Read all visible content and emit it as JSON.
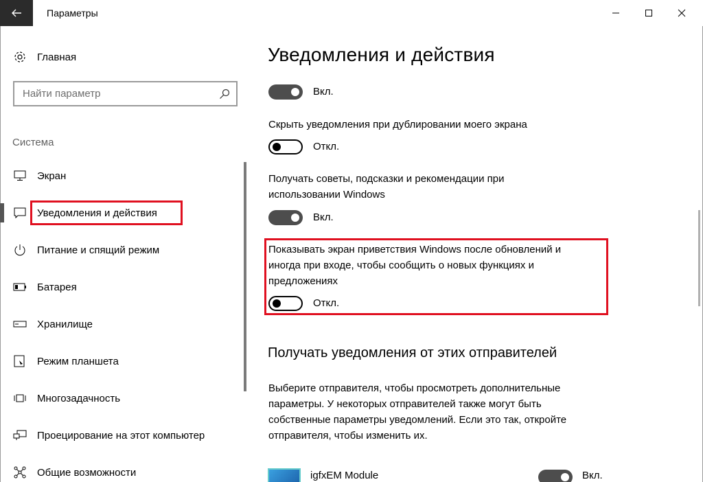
{
  "window": {
    "title": "Параметры"
  },
  "sidebar": {
    "home_label": "Главная",
    "search_placeholder": "Найти параметр",
    "section_label": "Система",
    "items": [
      {
        "label": "Экран",
        "icon": "monitor-icon"
      },
      {
        "label": "Уведомления и действия",
        "icon": "notification-icon",
        "active": true
      },
      {
        "label": "Питание и спящий режим",
        "icon": "power-icon"
      },
      {
        "label": "Батарея",
        "icon": "battery-icon"
      },
      {
        "label": "Хранилище",
        "icon": "storage-icon"
      },
      {
        "label": "Режим планшета",
        "icon": "tablet-icon"
      },
      {
        "label": "Многозадачность",
        "icon": "multitask-icon"
      },
      {
        "label": "Проецирование на этот компьютер",
        "icon": "project-icon"
      },
      {
        "label": "Общие возможности",
        "icon": "shared-icon"
      }
    ]
  },
  "main": {
    "title": "Уведомления и действия",
    "settings": [
      {
        "text": "",
        "state": "on",
        "state_label": "Вкл."
      },
      {
        "text": "Скрыть уведомления при дублировании моего экрана",
        "state": "off",
        "state_label": "Откл."
      },
      {
        "text_line1": "Получать советы, подсказки и рекомендации при",
        "text_line2": "использовании Windows",
        "state": "on",
        "state_label": "Вкл."
      },
      {
        "text_line1": "Показывать экран приветствия Windows после обновлений и",
        "text_line2": "иногда при входе, чтобы сообщить о новых функциях и",
        "text_line3": "предложениях",
        "state": "off",
        "state_label": "Откл."
      }
    ],
    "senders_heading": "Получать уведомления от этих отправителей",
    "senders_desc_line1": "Выберите отправителя, чтобы просмотреть дополнительные",
    "senders_desc_line2": "параметры. У некоторых отправителей также могут быть",
    "senders_desc_line3": "собственные параметры уведомлений. Если это так, откройте",
    "senders_desc_line4": "отправителя, чтобы изменить их.",
    "apps": [
      {
        "name": "igfxEM Module",
        "state": "on",
        "state_label": "Вкл."
      }
    ]
  },
  "colors": {
    "highlight": "#e01020",
    "toggle_on": "#4d4d4d",
    "titlebar_back": "#2b2b2b"
  }
}
